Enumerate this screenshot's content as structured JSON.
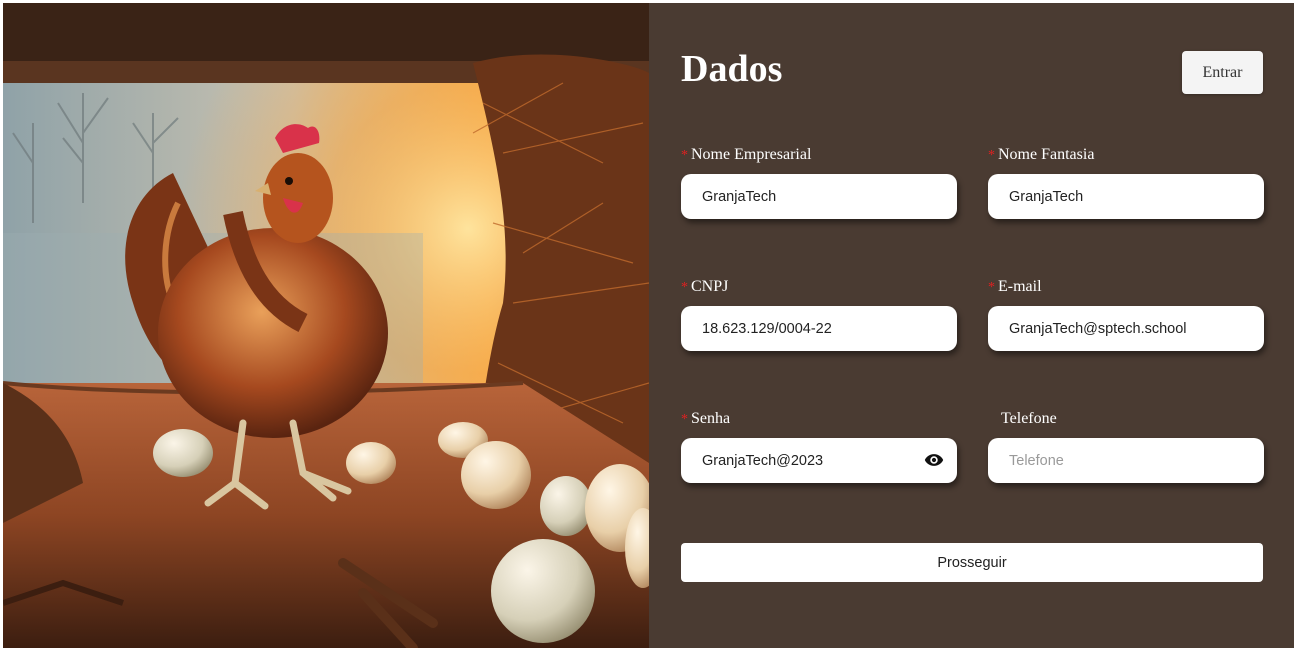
{
  "form": {
    "title": "Dados",
    "login_label": "Entrar",
    "required_mark": "*",
    "fields": [
      {
        "label": "Nome Empresarial",
        "value": "GranjaTech",
        "placeholder": "Nome Empresarial",
        "required": true
      },
      {
        "label": "Nome Fantasia",
        "value": "GranjaTech",
        "placeholder": "Nome Fantasia",
        "required": true
      },
      {
        "label": "CNPJ",
        "value": "18.623.129/0004-22",
        "placeholder": "CNPJ",
        "required": true
      },
      {
        "label": "E-mail",
        "value": "GranjaTech@sptech.school",
        "placeholder": "E-mail",
        "required": true
      },
      {
        "label": "Senha",
        "value": "GranjaTech@2023",
        "placeholder": "Senha",
        "required": true
      },
      {
        "label": "Telefone",
        "value": "",
        "placeholder": "Telefone",
        "required": false
      }
    ],
    "submit_label": "Prosseguir"
  },
  "icons": {
    "password_toggle": "eye-icon"
  },
  "colors": {
    "panel_background": "#4a3b32",
    "required_marker": "#e02020",
    "input_background": "#ffffff"
  }
}
